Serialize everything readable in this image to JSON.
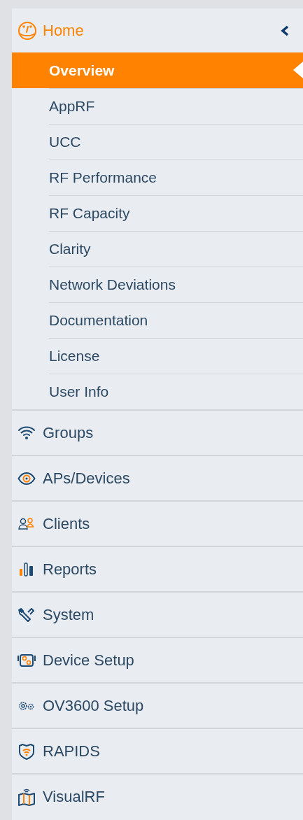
{
  "home": {
    "label": "Home",
    "expanded": true,
    "children": [
      {
        "label": "Overview",
        "selected": true
      },
      {
        "label": "AppRF",
        "selected": false
      },
      {
        "label": "UCC",
        "selected": false
      },
      {
        "label": "RF Performance",
        "selected": false
      },
      {
        "label": "RF Capacity",
        "selected": false
      },
      {
        "label": "Clarity",
        "selected": false
      },
      {
        "label": "Network Deviations",
        "selected": false
      },
      {
        "label": "Documentation",
        "selected": false
      },
      {
        "label": "License",
        "selected": false
      },
      {
        "label": "User Info",
        "selected": false
      }
    ]
  },
  "items": [
    {
      "label": "Groups",
      "kind": "wifi"
    },
    {
      "label": "APs/Devices",
      "kind": "eye"
    },
    {
      "label": "Clients",
      "kind": "users"
    },
    {
      "label": "Reports",
      "kind": "bars"
    },
    {
      "label": "System",
      "kind": "wrench"
    },
    {
      "label": "Device Setup",
      "kind": "device"
    },
    {
      "label": "OV3600 Setup",
      "kind": "gears"
    },
    {
      "label": "RAPIDS",
      "kind": "shield"
    },
    {
      "label": "VisualRF",
      "kind": "map"
    }
  ]
}
